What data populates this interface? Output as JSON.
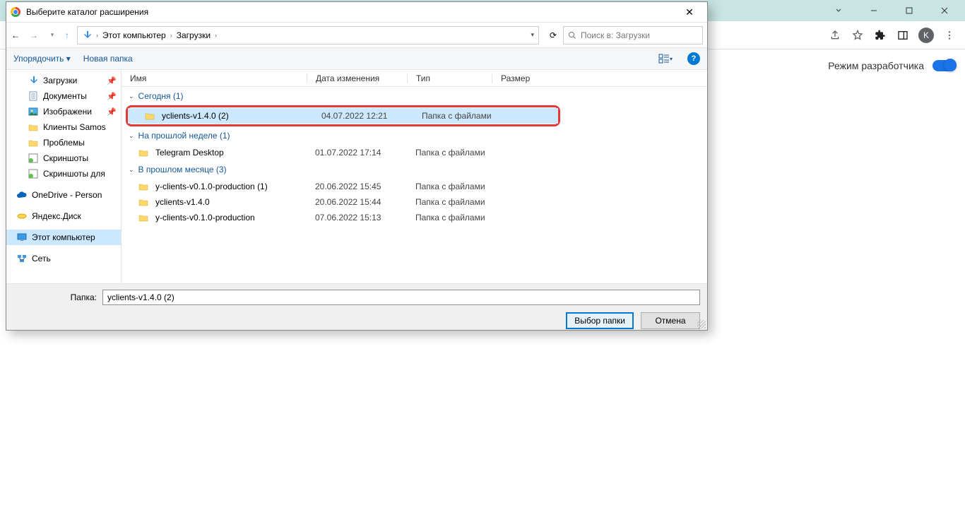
{
  "browser": {
    "dev_mode_label": "Режим разработчика",
    "avatar_letter": "K"
  },
  "dialog": {
    "title": "Выберите каталог расширения",
    "breadcrumb": {
      "root": "Этот компьютер",
      "folder": "Загрузки"
    },
    "search_placeholder": "Поиск в: Загрузки",
    "toolbar": {
      "organize": "Упорядочить",
      "new_folder": "Новая папка"
    },
    "columns": {
      "name": "Имя",
      "date": "Дата изменения",
      "type": "Тип",
      "size": "Размер"
    },
    "sidebar": {
      "downloads": "Загрузки",
      "documents": "Документы",
      "pictures": "Изображени",
      "clients": "Клиенты Samos",
      "problems": "Проблемы",
      "screenshots": "Скриншоты",
      "screenshots_for": "Скриншоты для",
      "onedrive": "OneDrive - Person",
      "yandex": "Яндекс.Диск",
      "this_pc": "Этот компьютер",
      "network": "Сеть"
    },
    "groups": [
      {
        "title": "Сегодня (1)",
        "rows": [
          {
            "name": "yclients-v1.4.0 (2)",
            "date": "04.07.2022 12:21",
            "type": "Папка с файлами",
            "highlight": true
          }
        ]
      },
      {
        "title": "На прошлой неделе (1)",
        "rows": [
          {
            "name": "Telegram Desktop",
            "date": "01.07.2022 17:14",
            "type": "Папка с файлами"
          }
        ]
      },
      {
        "title": "В прошлом месяце (3)",
        "rows": [
          {
            "name": "y-clients-v0.1.0-production (1)",
            "date": "20.06.2022 15:45",
            "type": "Папка с файлами"
          },
          {
            "name": "yclients-v1.4.0",
            "date": "20.06.2022 15:44",
            "type": "Папка с файлами"
          },
          {
            "name": "y-clients-v0.1.0-production",
            "date": "07.06.2022 15:13",
            "type": "Папка с файлами"
          }
        ]
      }
    ],
    "footer": {
      "label": "Папка:",
      "value": "yclients-v1.4.0 (2)",
      "select": "Выбор папки",
      "cancel": "Отмена"
    }
  }
}
